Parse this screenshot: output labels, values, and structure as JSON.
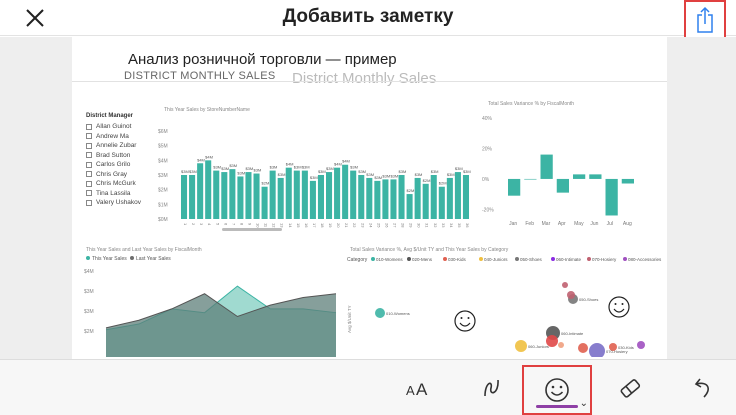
{
  "header": {
    "title": "Добавить заметку"
  },
  "report": {
    "title": "Анализ розничной торговли — пример",
    "subtitle": "DISTRICT MONTHLY SALES",
    "ghost_title": "District Monthly Sales"
  },
  "slicer": {
    "heading": "District Manager",
    "items": [
      "Allan Guinot",
      "Andrew Ma",
      "Annelie Zubar",
      "Brad Sutton",
      "Carlos Grilo",
      "Chris Gray",
      "Chris McGurk",
      "Tina Lassila",
      "Valery Ushakov"
    ]
  },
  "chart_data": [
    {
      "type": "bar",
      "title": "This Year Sales by StoreNumberName",
      "categories": [
        "1",
        "2",
        "3",
        "4",
        "5",
        "6",
        "7",
        "8",
        "9",
        "10",
        "11",
        "12",
        "13",
        "14",
        "15",
        "16",
        "17",
        "18",
        "19",
        "20",
        "21",
        "22",
        "23",
        "24",
        "25",
        "26",
        "27",
        "28",
        "29",
        "30",
        "31",
        "32",
        "33",
        "34",
        "35",
        "36"
      ],
      "values": [
        3.0,
        3.0,
        3.8,
        4.0,
        3.3,
        3.2,
        3.4,
        2.9,
        3.2,
        3.1,
        2.2,
        3.3,
        2.8,
        3.5,
        3.3,
        3.3,
        2.6,
        3.0,
        3.2,
        3.5,
        3.7,
        3.3,
        3.0,
        2.8,
        2.6,
        2.7,
        2.7,
        3.0,
        1.7,
        2.8,
        2.4,
        3.0,
        2.2,
        2.8,
        3.2,
        3.0
      ],
      "ylabel": "",
      "yticks": [
        "$0M",
        "$1M",
        "$2M",
        "$3M",
        "$4M",
        "$5M",
        "$6M"
      ],
      "ylim": [
        0,
        6
      ]
    },
    {
      "type": "bar",
      "title": "Total Sales Variance % by FiscalMonth",
      "categories": [
        "Jan",
        "Feb",
        "Mar",
        "Apr",
        "May",
        "Jun",
        "Jul",
        "Aug"
      ],
      "values": [
        -11,
        0,
        16,
        -9,
        3,
        3,
        -24,
        -3
      ],
      "yticks": [
        "-20%",
        "0%",
        "20%",
        "40%"
      ],
      "ylim": [
        -25,
        42
      ]
    },
    {
      "type": "area",
      "title": "This Year Sales and Last Year Sales by FiscalMonth",
      "legend": [
        "This Year Sales",
        "Last Year Sales"
      ],
      "series": [
        {
          "name": "This Year Sales",
          "values": [
            2.35,
            2.5,
            2.9,
            2.8,
            3.5,
            2.9,
            2.9,
            2.8
          ]
        },
        {
          "name": "Last Year Sales",
          "values": [
            2.4,
            2.6,
            2.9,
            3.3,
            2.7,
            3.0,
            3.2,
            3.3
          ]
        }
      ],
      "yticks": [
        "$2M",
        "$3M",
        "$3M",
        "$4M"
      ]
    },
    {
      "type": "scatter",
      "title": "Total Sales Variance %, Avg $/Unit TY and This Year Sales by Category",
      "legend_label": "Category",
      "legend": [
        "010-Womens",
        "020-Mens",
        "030-Kids",
        "040-Juniors",
        "050-Shoes",
        "060-Intimate",
        "070-Hosiery",
        "080-Accessories"
      ],
      "point_labels": [
        "010-Womens",
        "050-Shoes",
        "060-Juniors",
        "060-Intimate",
        "030-Kids",
        "070-Hosiery"
      ]
    }
  ],
  "toolbar": {
    "items": [
      "text-tool",
      "pen-tool",
      "emoji-tool",
      "eraser-tool",
      "undo"
    ]
  },
  "colors": {
    "teal": "#3cb4a4",
    "gray": "#6e6e6e",
    "highlight": "#e04040",
    "accent_underline": "#8e3fa5",
    "share_blue": "#2f80ed"
  }
}
